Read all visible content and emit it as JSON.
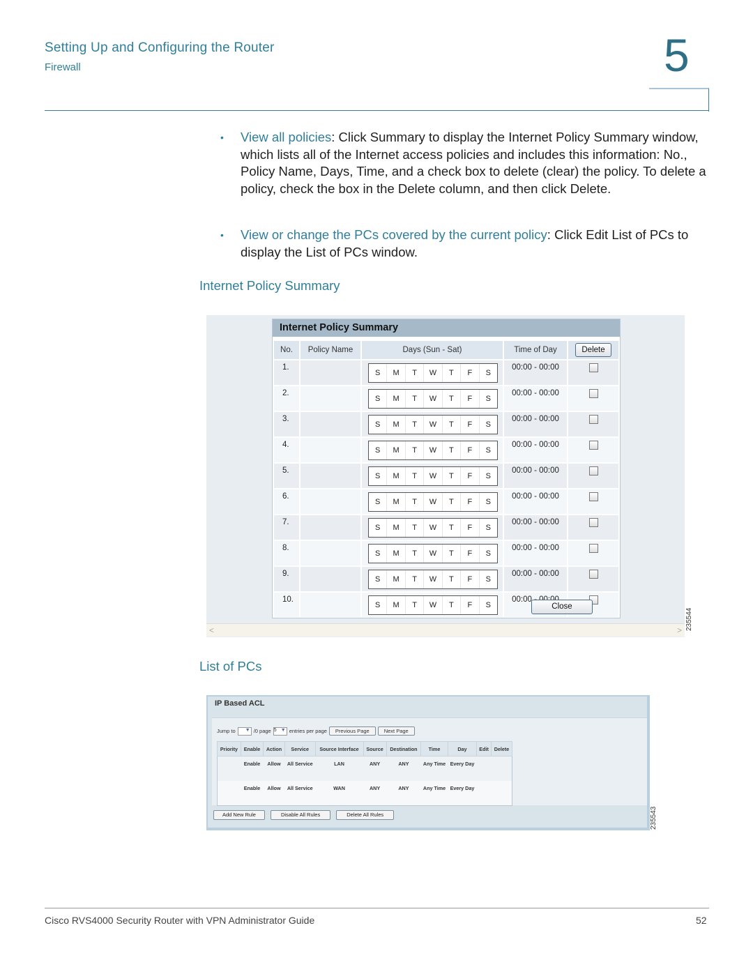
{
  "header": {
    "chapter_title": "Setting Up and Configuring the Router",
    "section_title": "Firewall",
    "chapter_number": "5"
  },
  "bullets": [
    {
      "lead": "View all policies",
      "sep": ": ",
      "text": "Click Summary to display the Internet Policy Summary window, which lists all of the Internet access policies and includes this information: No., Policy Name, Days, Time, and a check box to delete (clear) the policy. To delete a policy, check the box in the Delete column, and then click Delete."
    },
    {
      "lead": "View or change the PCs covered by the current policy",
      "sep": ": ",
      "text": "Click Edit List of PCs to display the List of PCs window."
    }
  ],
  "figure1": {
    "caption": "Internet Policy Summary",
    "panel_title": "Internet Policy Summary",
    "columns": [
      "No.",
      "Policy Name",
      "Days (Sun - Sat)",
      "Time of Day"
    ],
    "delete_button": "Delete",
    "close_button": "Close",
    "day_letters": [
      "S",
      "M",
      "T",
      "W",
      "T",
      "F",
      "S"
    ],
    "rows": [
      {
        "no": "1.",
        "name": "",
        "time": "00:00 - 00:00",
        "checked": false
      },
      {
        "no": "2.",
        "name": "",
        "time": "00:00 - 00:00",
        "checked": false
      },
      {
        "no": "3.",
        "name": "",
        "time": "00:00 - 00:00",
        "checked": false
      },
      {
        "no": "4.",
        "name": "",
        "time": "00:00 - 00:00",
        "checked": false
      },
      {
        "no": "5.",
        "name": "",
        "time": "00:00 - 00:00",
        "checked": false
      },
      {
        "no": "6.",
        "name": "",
        "time": "00:00 - 00:00",
        "checked": false
      },
      {
        "no": "7.",
        "name": "",
        "time": "00:00 - 00:00",
        "checked": false
      },
      {
        "no": "8.",
        "name": "",
        "time": "00:00 - 00:00",
        "checked": false
      },
      {
        "no": "9.",
        "name": "",
        "time": "00:00 - 00:00",
        "checked": false
      },
      {
        "no": "10.",
        "name": "",
        "time": "00:00 - 00:00",
        "checked": false
      }
    ],
    "figure_id": "235544"
  },
  "figure2": {
    "caption": "List of PCs",
    "panel_title": "IP Based ACL",
    "toolbar": {
      "jump_to_label": "Jump to",
      "jump_to_value": "",
      "page_label": "/0 page",
      "entries_value": "5",
      "entries_label": "entries per page",
      "prev_button": "Previous Page",
      "next_button": "Next Page"
    },
    "columns": [
      "Priority",
      "Enable",
      "Action",
      "Service",
      "Source Interface",
      "Source",
      "Destination",
      "Time",
      "Day",
      "Edit",
      "Delete"
    ],
    "rows": [
      {
        "priority": "",
        "enable": "Enable",
        "action": "Allow",
        "service": "All Service",
        "source_interface": "LAN",
        "source": "ANY",
        "destination": "ANY",
        "time": "Any Time",
        "day": "Every Day",
        "edit": "",
        "delete": ""
      },
      {
        "priority": "",
        "enable": "Enable",
        "action": "Allow",
        "service": "All Service",
        "source_interface": "WAN",
        "source": "ANY",
        "destination": "ANY",
        "time": "Any Time",
        "day": "Every Day",
        "edit": "",
        "delete": ""
      }
    ],
    "footer_buttons": [
      "Add New Rule",
      "Disable All Rules",
      "Delete All Rules"
    ],
    "figure_id": "235543"
  },
  "footer": {
    "guide_title": "Cisco RVS4000 Security Router with VPN Administrator Guide",
    "page_number": "52"
  }
}
